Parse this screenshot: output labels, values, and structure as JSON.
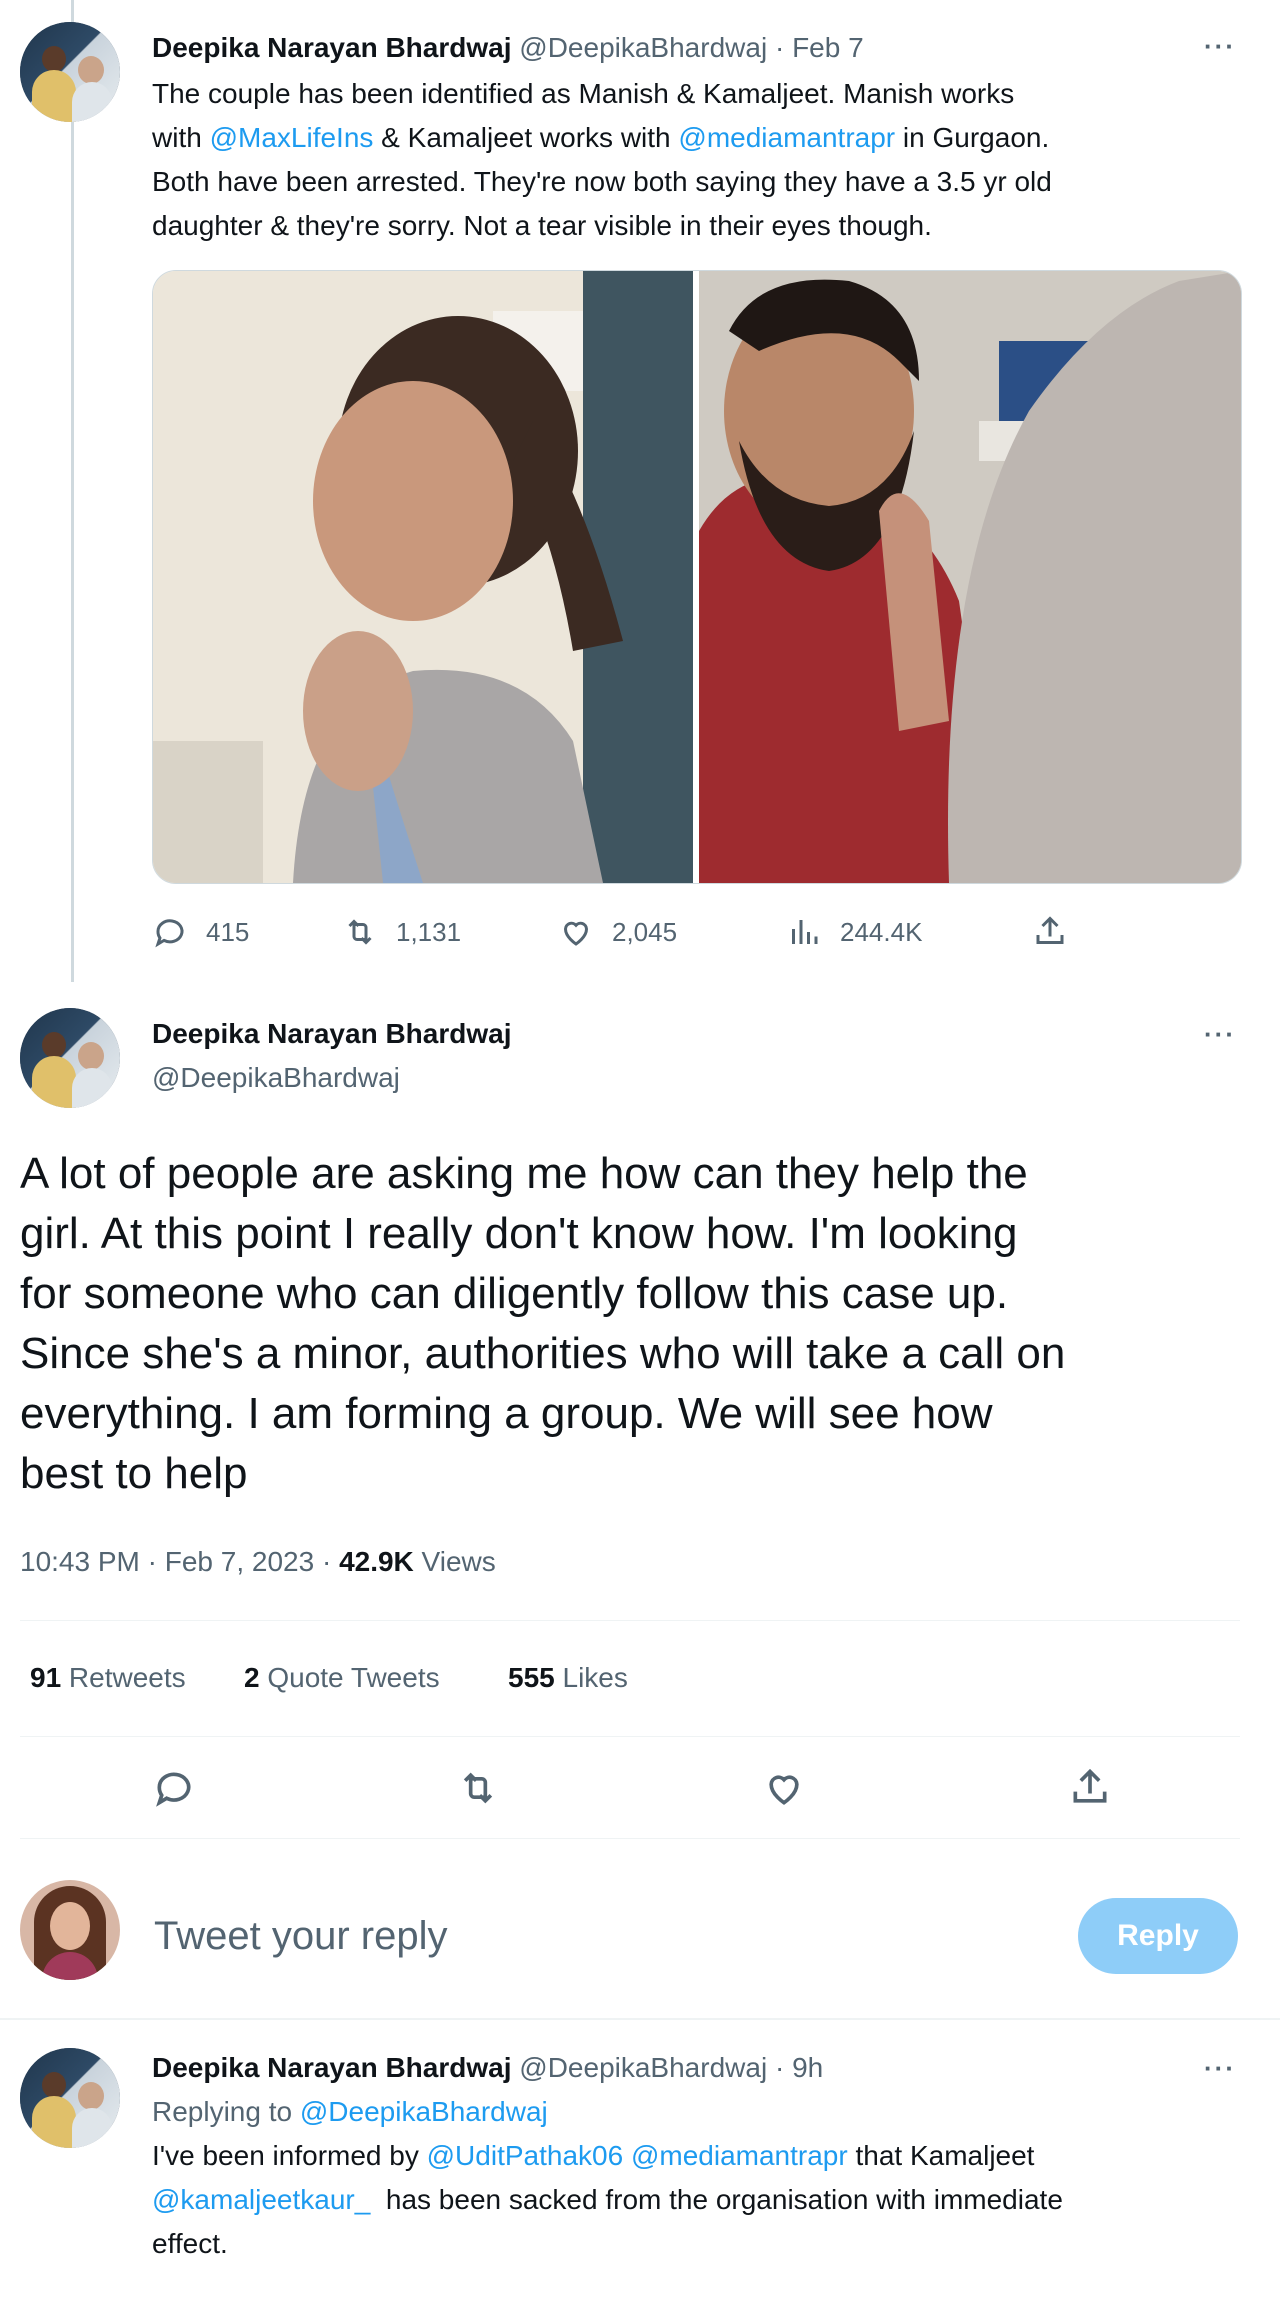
{
  "colors": {
    "accent": "#1d9bf0",
    "reply_button": "#8ecdf8",
    "text": "#0f1419",
    "secondary": "#536471"
  },
  "tweet1": {
    "author_name": "Deepika Narayan Bhardwaj",
    "handle": "@DeepikaBhardwaj",
    "separator": "·",
    "time": "Feb 7",
    "more": "···",
    "text_line1": "The couple has been identified as Manish & Kamaljeet. Manish works",
    "text_line2_a": "with ",
    "mention1": "@MaxLifeIns",
    "text_line2_b": " & Kamaljeet works with ",
    "mention2": "@mediamantrapr",
    "text_line2_c": " in Gurgaon.",
    "text_line3": "Both have been arrested. They're now both saying they have a 3.5 yr old",
    "text_line4": "daughter & they're sorry. Not a tear visible in their eyes though.",
    "replies": "415",
    "retweets": "1,131",
    "likes": "2,045",
    "views": "244.4K"
  },
  "tweet2": {
    "author_name": "Deepika Narayan Bhardwaj",
    "handle": "@DeepikaBhardwaj",
    "more": "···",
    "lines": [
      "A lot of people are asking me how can they help the",
      "girl. At this point I really don't know how. I'm looking",
      "for someone who can diligently follow this case up.",
      "Since she's a minor, authorities who will take a call on",
      "everything. I am forming a group. We will see how",
      "best to help"
    ],
    "timestamp": "10:43 PM · Feb 7, 2023 · ",
    "views_count": "42.9K",
    "views_label": " Views",
    "retweets_count": "91",
    "retweets_label": " Retweets",
    "quotes_count": "2",
    "quotes_label": " Quote Tweets",
    "likes_count": "555",
    "likes_label": " Likes"
  },
  "composer": {
    "placeholder": "Tweet your reply",
    "reply_button": "Reply"
  },
  "tweet3": {
    "author_name": "Deepika Narayan Bhardwaj",
    "handle": "@DeepikaBhardwaj",
    "separator": "·",
    "time": "9h",
    "more": "···",
    "replying_label": "Replying to ",
    "replying_handle": "@DeepikaBhardwaj",
    "text_a": "I've been informed by ",
    "mention1": "@UditPathak06",
    "mention2": "@mediamantrapr",
    "text_b": " that Kamaljeet",
    "mention3": "@kamaljeetkaur_",
    "text_c": "  has been sacked from the organisation with immediate",
    "text_d": "effect."
  }
}
